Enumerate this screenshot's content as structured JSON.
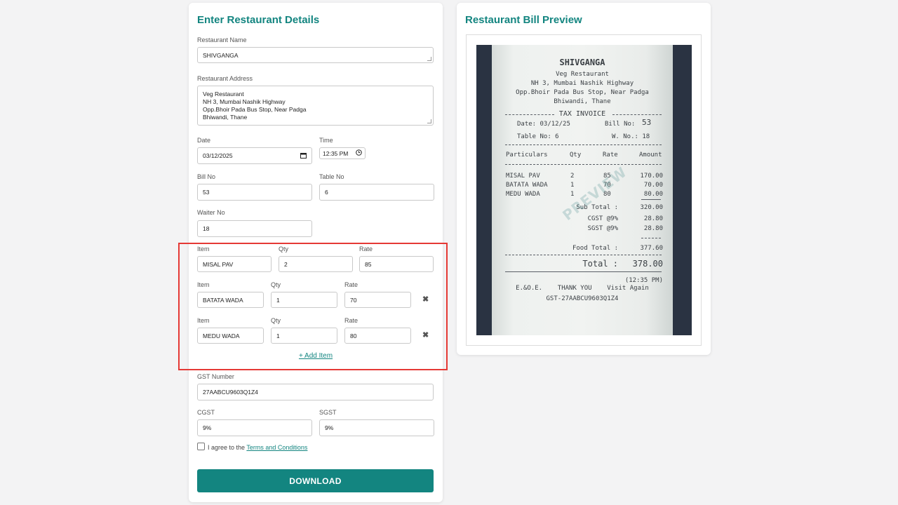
{
  "form": {
    "title": "Enter Restaurant Details",
    "restaurant_name_label": "Restaurant Name",
    "restaurant_name": "SHIVGANGA",
    "restaurant_address_label": "Restaurant Address",
    "restaurant_address": "Veg Restaurant\nNH 3, Mumbai Nashik Highway\nOpp.Bhoir Pada Bus Stop, Near Padga\nBhiwandi, Thane",
    "date_label": "Date",
    "date": "03/12/2025",
    "time_label": "Time",
    "time": "12:35 PM",
    "bill_no_label": "Bill No",
    "bill_no": "53",
    "table_no_label": "Table No",
    "table_no": "6",
    "waiter_no_label": "Waiter No",
    "waiter_no": "18",
    "item_label": "Item",
    "qty_label": "Qty",
    "rate_label": "Rate",
    "items": [
      {
        "name": "MISAL PAV",
        "qty": "2",
        "rate": "85"
      },
      {
        "name": "BATATA WADA",
        "qty": "1",
        "rate": "70"
      },
      {
        "name": "MEDU WADA",
        "qty": "1",
        "rate": "80"
      }
    ],
    "add_item_label": "+ Add Item",
    "gst_number_label": "GST Number",
    "gst_number": "27AABCU9603Q1Z4",
    "cgst_label": "CGST",
    "cgst": "9%",
    "sgst_label": "SGST",
    "sgst": "9%",
    "agree_text": "I agree to the",
    "terms_link": "Terms and Conditions",
    "download_label": "DOWNLOAD"
  },
  "preview": {
    "title": "Restaurant Bill Preview",
    "receipt": {
      "name": "SHIVGANGA",
      "line1": "Veg Restaurant",
      "line2": "NH 3, Mumbai Nashik Highway",
      "line3": "Opp.Bhoir Pada Bus Stop, Near Padga",
      "line4": "Bhiwandi, Thane",
      "tax_invoice": "TAX INVOICE",
      "date": "Date: 03/12/25",
      "bill_no_label": "Bill No:",
      "bill_no": "53",
      "table_no": "Table No: 6",
      "waiter_no": "W. No.: 18",
      "headers": [
        "Particulars",
        "Qty",
        "Rate",
        "Amount"
      ],
      "rows": [
        [
          "MISAL PAV",
          "2",
          "85",
          "170.00"
        ],
        [
          "BATATA WADA",
          "1",
          "70",
          "70.00"
        ],
        [
          "MEDU WADA",
          "1",
          "80",
          "80.00"
        ]
      ],
      "sub_total_label": "Sub Total :",
      "sub_total": "320.00",
      "cgst_label": "CGST @9%",
      "cgst": "28.80",
      "sgst_label": "SGST @9%",
      "sgst": "28.80",
      "food_total_label": "Food Total :",
      "food_total": "377.60",
      "total_label": "Total :",
      "total": "378.00",
      "time": "(12:35 PM)",
      "footer": "E.&O.E.    THANK YOU    Visit Again",
      "gst": "GST-27AABCU9603Q1Z4",
      "watermark": "PREVIEW"
    }
  }
}
